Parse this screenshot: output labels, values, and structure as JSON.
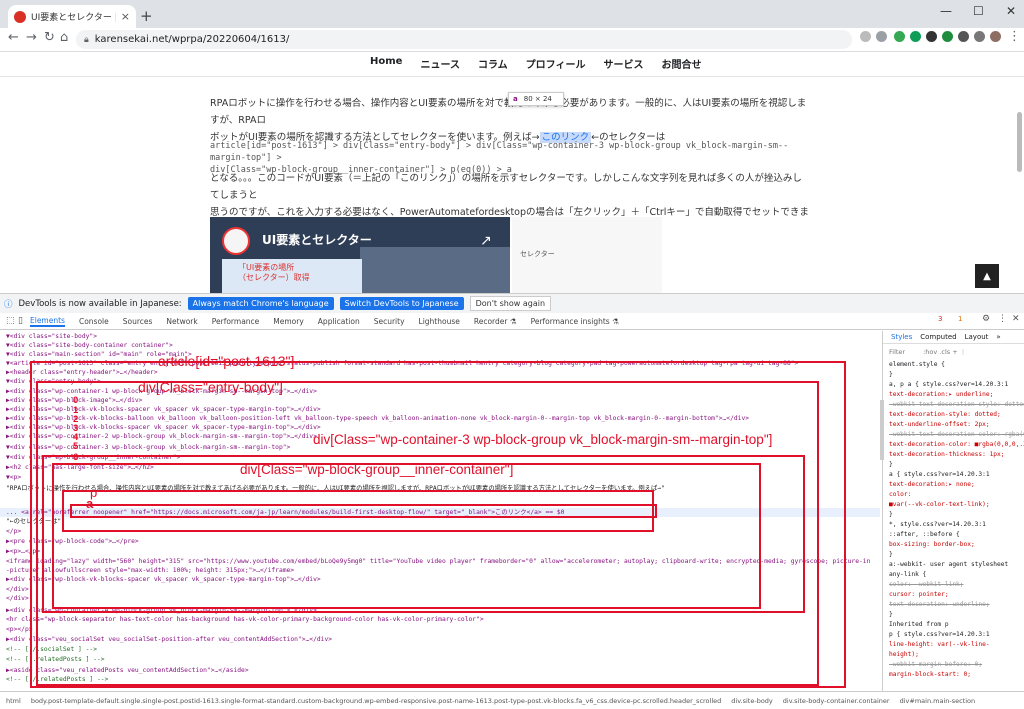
{
  "browser": {
    "tab_title": "UI要素とセレクター | ちいさなRPAこ",
    "tab_close": "×",
    "new_tab": "+",
    "url": "karensekai.net/wprpa/20220604/1613/",
    "win_min": "—",
    "win_max": "☐",
    "win_close": "✕"
  },
  "site_nav": [
    "Home",
    "ニュース",
    "コラム",
    "プロフィール",
    "サービス",
    "お問合せ"
  ],
  "article": {
    "p1_line1": "RPAロボットに操作を行わせる場合、操作内容とUI要素の場所を対で教えてあげる必要があります。一般的に、人はUI要素の場所を視認しますが、RPAロ",
    "p1_line2a": "ボットがUI要素の場所を認識する方法としてセレクターを使います。例えば→",
    "p1_link": "このリンク",
    "p1_line2b": "←のセレクターは",
    "selector_line1": "article[id=\"post-1613\"] > div[Class=\"entry-body\"] > div[Class=\"wp-container-3 wp-block-group vk_block-margin-sm--margin-top\"] >",
    "selector_line2": "div[Class=\"wp-block-group__inner-container\"] > p(eq(0)) > a",
    "p2_line1": "となる。。。このコードがUI要素（＝上記の「このリンク」）の場所を示すセレクターです。しかしこんな文字列を見れば多くの人が挫込みしてしまうと",
    "p2_line2": "思うのですが、これを入力する必要はなく、PowerAutomatefordesktopの場合は「左クリック」＋「Ctrlキー」で自動取得でセットできます。",
    "tooltip_tag": "a",
    "tooltip_size": "80 × 24",
    "thumb_title": "UI要素とセレクター",
    "thumb_caption_1": "「UI要素の場所",
    "thumb_caption_2": "（セレクター）取得",
    "thumb_share": "↗",
    "thumb_right_text": "セレクター",
    "scroll_top": "▲"
  },
  "devtools": {
    "notice": "DevTools is now available in Japanese:",
    "btn_match": "Always match Chrome's language",
    "btn_switch": "Switch DevTools to Japanese",
    "btn_dont": "Don't show again",
    "tabs": [
      "Elements",
      "Console",
      "Sources",
      "Network",
      "Performance",
      "Memory",
      "Application",
      "Security",
      "Lighthouse",
      "Recorder ⚗",
      "Performance insights ⚗"
    ],
    "badge_err": "3",
    "badge_warn": "1",
    "styles_tabs": [
      "Styles",
      "Computed",
      "Layout",
      "»"
    ],
    "filter_placeholder": "Filter",
    "filter_hov": ":hov .cls + ⋮",
    "dom_lines": [
      "▼<div class=\"site-body\">",
      "  ▼<div class=\"site-body-container container\">",
      "    ▼<div class=\"main-section\" id=\"main\" role=\"main\">",
      "      ▼<article id=\"post-1613\" class=\"entry entry-full post-1613 post type-post status-publish format-standard has-post-thumbnail hentry category-blog category-pad tag-powerautomatefordesktop tag-rpa tag-ui tag-88\">",
      "        ▶<header class=\"entry-header\">…</header>",
      "        ▼<div class=\"entry-body\">",
      "          ▶<div class=\"wp-container-1 wp-block-group vk_block-margin-sm--margin-top\">…</div>",
      "          ▶<div class=\"wp-block-image\">…</div>",
      "          ▶<div class=\"wp-block-vk-blocks-spacer vk_spacer vk_spacer-type-margin-top\">…</div>",
      "          ▶<div class=\"wp-block-vk-blocks-balloon vk_balloon vk_balloon-position-left vk_balloon-type-speech vk_balloon-animation-none vk_block-margin-0--margin-top vk_block-margin-0--margin-bottom\">…</div>",
      "          ▶<div class=\"wp-block-vk-blocks-spacer vk_spacer vk_spacer-type-margin-top\">…</div>",
      "          ▶<div class=\"wp-container-2 wp-block-group vk_block-margin-sm--margin-top\">…</div>",
      "          ▼<div class=\"wp-container-3 wp-block-group vk_block-margin-sm--margin-top\">",
      "            ▼<div class=\"wp-block-group__inner-container\">",
      "              ▶<h2 class=\"has-large-font-size\">…</h2>",
      "              ▼<p>",
      "                \"RPAロボットに操作を行わせる場合、操作内容とUI要素の場所を対で教えてあげる必要があります。一般的に、人はUI要素の場所を視認しますが、RPAロボットがUI要素の場所を認識する方法としてセレクターを使います。例えば→\"",
      "... <a rel=\"noreferrer noopener\" href=\"https://docs.microsoft.com/ja-jp/learn/modules/build-first-desktop-flow/\" target=\"_blank\">このリンク</a> == $0",
      "                \"←のセレクターは\"",
      "              </p>",
      "              ▶<pre class=\"wp-block-code\">…</pre>",
      "              ▶<p>…</p>",
      "              <iframe loading=\"lazy\" width=\"560\" height=\"315\" src=\"https://www.youtube.com/embed/bLoQe9y5mg0\" title=\"YouTube video player\" frameborder=\"0\" allow=\"accelerometer; autoplay; clipboard-write; encrypted-media; gyroscope; picture-in",
      "              -picture\" allowfullscreen style=\"max-width: 100%; height: 315px;\">…</iframe>",
      "              ▶<div class=\"wp-block-vk-blocks-spacer vk_spacer vk_spacer-type-margin-top\">…</div>",
      "            </div>",
      "          </div>",
      "          ▶<div class=\"wp-container-4 wp-block-group vk_block-margin-sm--margin-top\">…</div>",
      "          <hr class=\"wp-block-separator has-text-color has-background has-vk-color-primary-background-color has-vk-color-primary-color\">",
      "          <p></p>",
      "          ▶<div class=\"veu_socialSet veu_socialSet-position-after veu_contentAddSection\">…</div>",
      "          <!-- [ /.socialSet ] -->",
      "          <!-- [ .relatedPosts ] -->",
      "          ▶<aside class=\"veu_relatedPosts veu_contentAddSection\">…</aside>",
      "          <!-- [ /.relatedPosts ] -->"
    ],
    "annotations": {
      "article": "article[id=\"post-1613\"]",
      "entry_body": "div[Class=\"entry-body\"]",
      "container3": "div[Class=\"wp-container-3 wp-block-group vk_block-margin-sm--margin-top\"]",
      "inner": "div[Class=\"wp-block-group__inner-container\"]",
      "p": "p",
      "a": "a",
      "numbers": [
        "0",
        "1",
        "2",
        "3",
        "4",
        "5",
        "6"
      ]
    },
    "styles_lines": [
      "element.style {",
      "}",
      "a, p a {          style.css?ver=14.20.3:1",
      "  text-decoration:▸ underline;",
      "  -webkit-text-decoration-style: dotted;",
      "  text-decoration-style: dotted;",
      "  text-underline-offset: 2px;",
      "  -webkit-text-decoration-color: rgba(0,0,0,.3);",
      "  text-decoration-color: ■rgba(0,0,0,.3);",
      "  text-decoration-thickness: 1px;",
      "}",
      "a {               style.css?ver=14.20.3:1",
      "  text-decoration:▸ none;",
      "  color:",
      "    ■var(--vk-color-text-link);",
      "}",
      "*,               style.css?ver=14.20.3:1",
      "::after, ::before {",
      "  box-sizing: border-box;",
      "}",
      "a:-webkit-       user agent stylesheet",
      "any-link {",
      "  color: -webkit-link;",
      "  cursor: pointer;",
      "  text-decoration: underline;",
      "}",
      "Inherited from p",
      "p {               style.css?ver=14.20.3:1",
      "  line-height: var(--vk-line-",
      "    height);",
      "  -webkit-margin-before: 0;",
      "  margin-block-start: 0;"
    ],
    "breadcrumbs": [
      "html",
      "body.post-template-default.single.single-post.postid-1613.single-format-standard.custom-background.wp-embed-responsive.post-name-1613.post-type-post.vk-blocks.fa_v6_css.device-pc.scrolled.header_scrolled",
      "div.site-body",
      "div.site-body-container.container",
      "div#main.main-section"
    ]
  }
}
